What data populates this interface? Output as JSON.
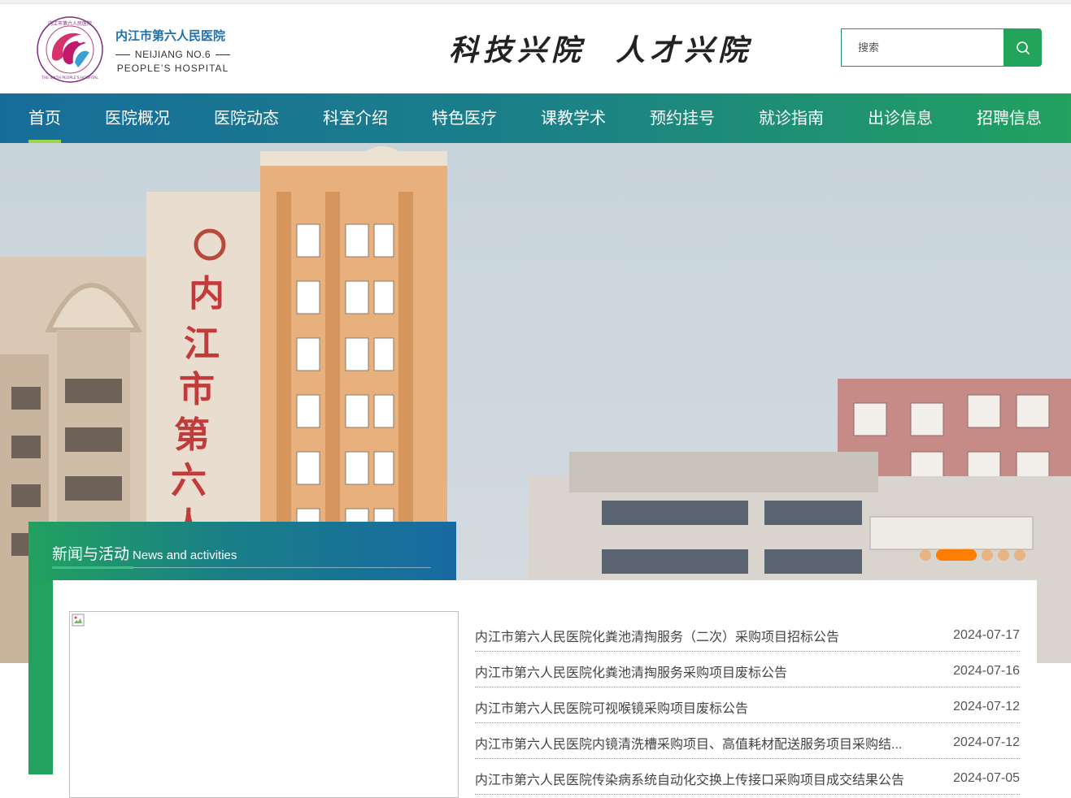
{
  "header": {
    "logo_cn": "内江市第六人民医院",
    "logo_en_1": "NEIJIANG NO.6",
    "logo_en_2": "PEOPLE’S HOSPITAL",
    "logo_seal_text": "内江市第六人民医院 THE SIXTH PEOPLE'S HOSPITAL OF NEIJIANG",
    "slogan": "科技兴院  人才兴院",
    "search_placeholder": "搜索",
    "search_icon": "search-icon"
  },
  "nav": {
    "items": [
      {
        "label": "首页",
        "active": true
      },
      {
        "label": "医院概况"
      },
      {
        "label": "医院动态"
      },
      {
        "label": "科室介绍"
      },
      {
        "label": "特色医疗"
      },
      {
        "label": "课教学术"
      },
      {
        "label": "预约挂号"
      },
      {
        "label": "就诊指南"
      },
      {
        "label": "出诊信息"
      },
      {
        "label": "招聘信息"
      }
    ]
  },
  "banner": {
    "building_sign": "内江市第六人",
    "slide_count": 6,
    "active_slide": 2
  },
  "news": {
    "title_cn": "新闻与活动",
    "title_en": "News and activities",
    "items": [
      {
        "title": "内江市第六人民医院化粪池清掏服务（二次）采购项目招标公告",
        "date": "2024-07-17"
      },
      {
        "title": "内江市第六人民医院化粪池清掏服务采购项目废标公告",
        "date": "2024-07-16"
      },
      {
        "title": "内江市第六人民医院可视喉镜采购项目废标公告",
        "date": "2024-07-12"
      },
      {
        "title": "内江市第六人民医院内镜清洗槽采购项目、高值耗材配送服务项目采购结...",
        "date": "2024-07-12"
      },
      {
        "title": "内江市第六人民医院传染病系统自动化交换上传接口采购项目成交结果公告",
        "date": "2024-07-05"
      }
    ]
  },
  "colors": {
    "nav_gradient_start": "#176d9a",
    "nav_gradient_end": "#22a15f",
    "nav_active_underline": "#9bd648",
    "search_button": "#22a45b",
    "dot_active": "#ff7d00",
    "logo_text": "#1f6fa8"
  }
}
